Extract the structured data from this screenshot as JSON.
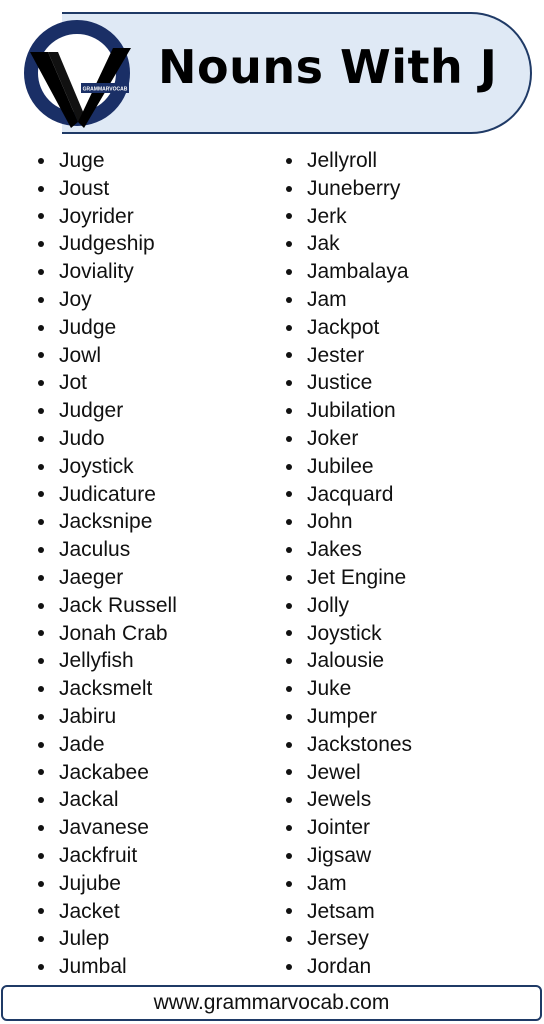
{
  "header": {
    "title": "Nouns With J",
    "logo_text": "GRAMMARVOCAB"
  },
  "colors": {
    "navy": "#1f3a66",
    "header_bg": "#dfe9f5",
    "text": "#111111"
  },
  "lists": {
    "left": [
      "Juge",
      "Joust",
      "Joyrider",
      "Judgeship",
      "Joviality",
      "Joy",
      "Judge",
      "Jowl",
      "Jot",
      "Judger",
      "Judo",
      "Joystick",
      "Judicature",
      "Jacksnipe",
      "Jaculus",
      "Jaeger",
      "Jack Russell",
      "Jonah Crab",
      "Jellyfish",
      "Jacksmelt",
      "Jabiru",
      "Jade",
      "Jackabee",
      "Jackal",
      "Javanese",
      "Jackfruit",
      "Jujube",
      "Jacket",
      "Julep",
      "Jumbal"
    ],
    "right": [
      "Jellyroll",
      "Juneberry",
      "Jerk",
      "Jak",
      "Jambalaya",
      "Jam",
      "Jackpot",
      "Jester",
      "Justice",
      "Jubilation",
      "Joker",
      "Jubilee",
      "Jacquard",
      "John",
      "Jakes",
      "Jet Engine",
      "Jolly",
      "Joystick",
      "Jalousie",
      "Juke",
      "Jumper",
      "Jackstones",
      "Jewel",
      "Jewels",
      "Jointer",
      "Jigsaw",
      "Jam",
      "Jetsam",
      "Jersey",
      "Jordan"
    ]
  },
  "footer": {
    "website": "www.grammarvocab.com"
  }
}
